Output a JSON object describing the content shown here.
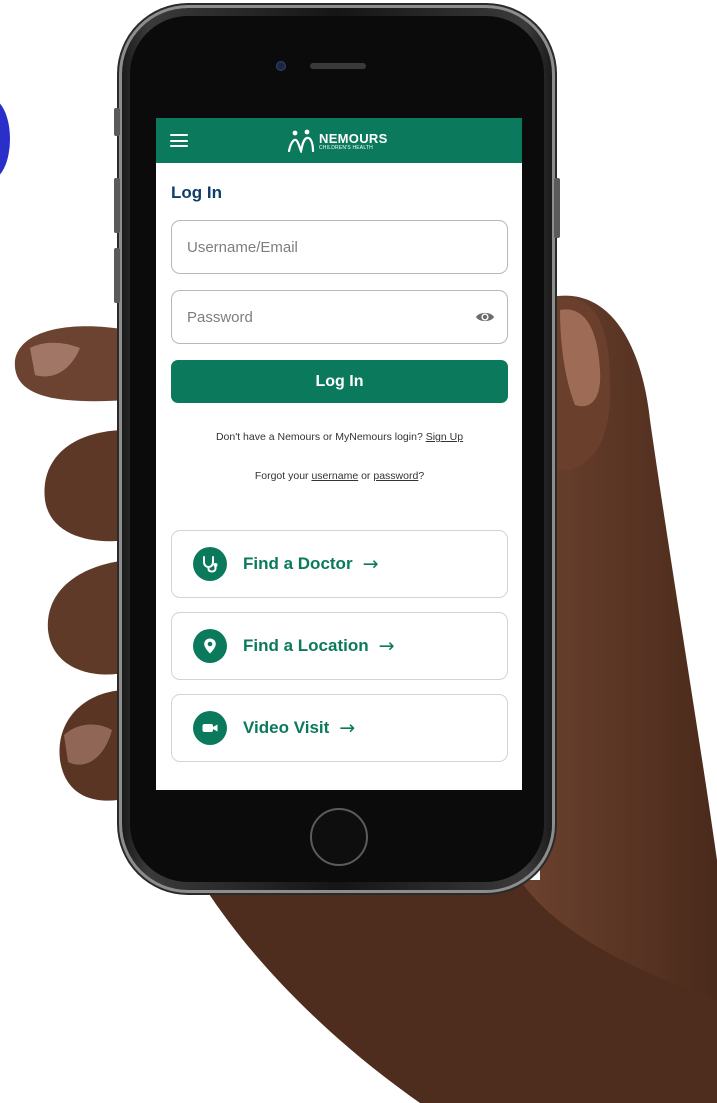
{
  "app": {
    "brand_name": "NEMOURS",
    "brand_subtitle": "CHILDREN'S HEALTH",
    "accent_color": "#0b7a5c",
    "title_color": "#0e3d6b"
  },
  "topbar": {
    "menu_icon": "hamburger-menu-icon"
  },
  "login": {
    "title": "Log In",
    "username_placeholder": "Username/Email",
    "username_value": "",
    "password_placeholder": "Password",
    "password_value": "",
    "password_toggle_icon": "eye-icon",
    "submit_label": "Log In"
  },
  "signup": {
    "prefix": "Don't have a Nemours or MyNemours login?",
    "link": "Sign Up"
  },
  "forgot": {
    "prefix": "Forgot your",
    "username_link": "username",
    "middle": "or",
    "password_link": "password",
    "suffix": "?"
  },
  "quick_links": [
    {
      "label": "Find a Doctor",
      "icon": "stethoscope-icon",
      "arrow": "→"
    },
    {
      "label": "Find a Location",
      "icon": "map-pin-icon",
      "arrow": "→"
    },
    {
      "label": "Video Visit",
      "icon": "video-camera-icon",
      "arrow": "→"
    }
  ]
}
